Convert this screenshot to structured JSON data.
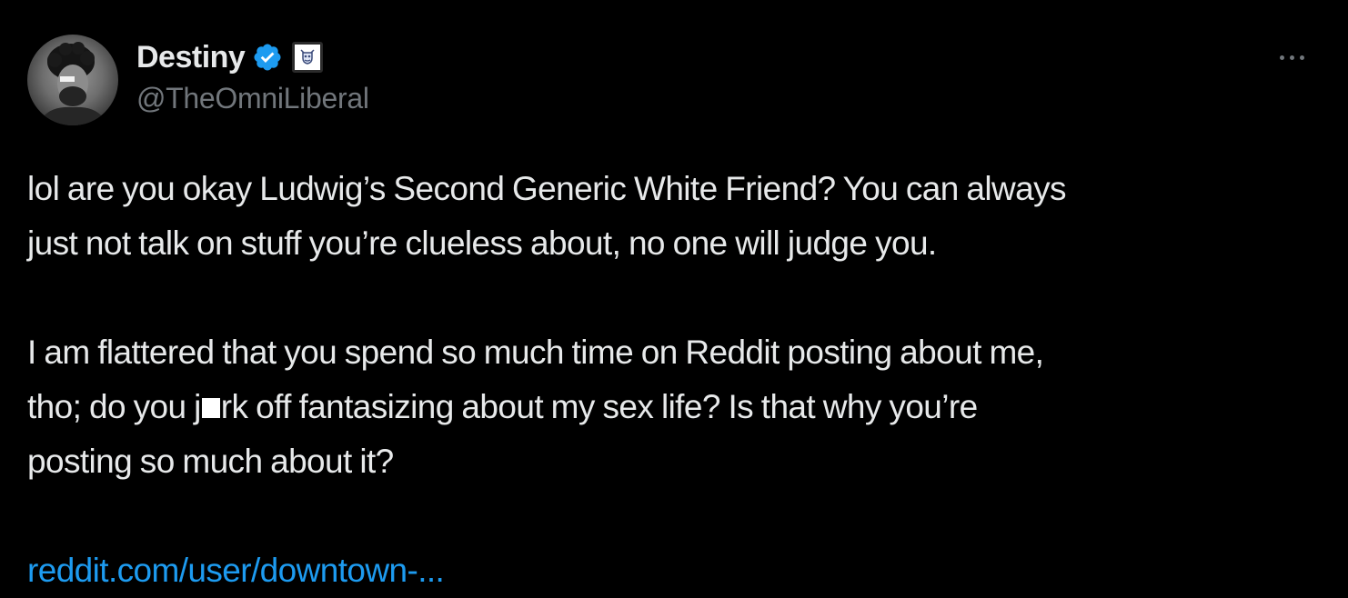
{
  "author": {
    "display_name": "Destiny",
    "handle": "@TheOmniLiberal",
    "verified_icon": "verified-badge-icon",
    "affiliate_icon": "affiliate-badge-icon",
    "avatar": "profile-avatar"
  },
  "more_icon": "more-options-icon",
  "tweet": {
    "paragraph_1": "lol are you okay Ludwig’s Second Generic White Friend? You can always\njust not talk on stuff you’re clueless about, no one will judge you.",
    "paragraph_2_part_1": "I am flattered that you spend so much time on Reddit posting about me,\ntho; do you j",
    "paragraph_2_part_2": "rk off fantasizing about my sex life? Is that why you’re\nposting so much about it?",
    "link_text": "reddit.com/user/downtown-..."
  },
  "colors": {
    "background": "#000000",
    "text": "#e7e9ea",
    "secondary_text": "#71767b",
    "link": "#1d9bf0",
    "verified": "#1d9bf0"
  }
}
